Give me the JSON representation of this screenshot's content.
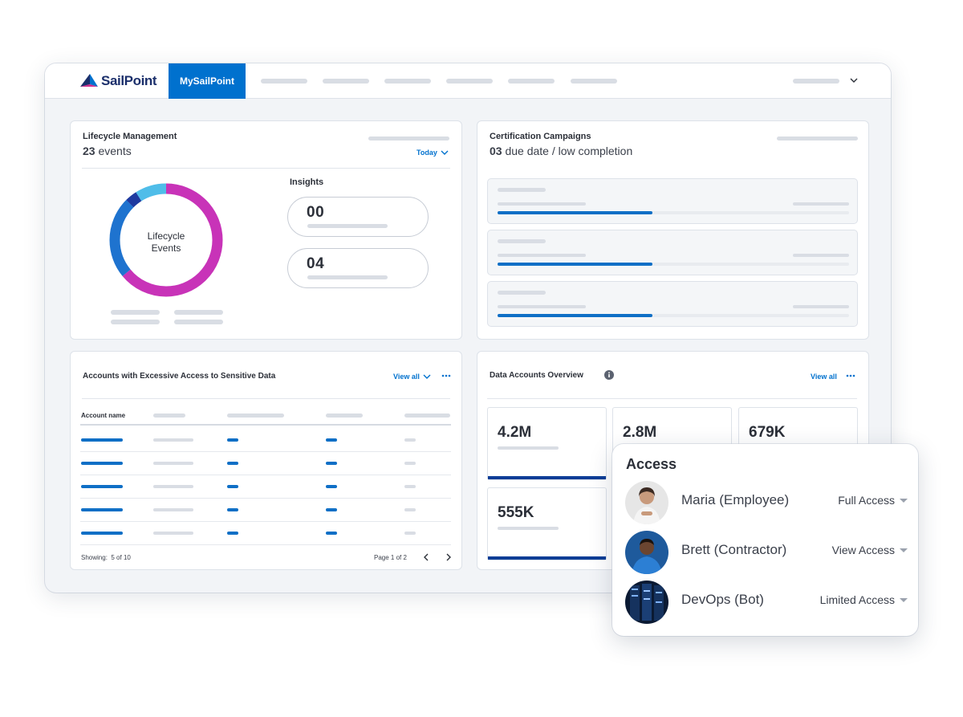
{
  "brand": {
    "name": "SailPoint",
    "tab": "MySailPoint"
  },
  "colors": {
    "primary": "#0071ce",
    "navy": "#0c3d96",
    "magenta": "#c833b8",
    "light_blue": "#4fbde9",
    "dark_blue": "#1f3aa0"
  },
  "lifecycle": {
    "title": "Lifecycle Management",
    "count": "23",
    "count_suffix": "events",
    "period": "Today",
    "donut_label_line1": "Lifecycle",
    "donut_label_line2": "Events",
    "insights_label": "Insights",
    "insights": [
      "00",
      "04"
    ]
  },
  "certification": {
    "title": "Certification Campaigns",
    "count": "03",
    "count_suffix": "due date / low completion",
    "progress": [
      0.44,
      0.44,
      0.44
    ]
  },
  "accounts": {
    "title": "Accounts with Excessive Access to Sensitive Data",
    "view_all": "View all",
    "column_header": "Account name",
    "row_count": 5,
    "showing_label": "Showing:",
    "showing_value": "5 of 10",
    "page": "Page 1 of 2"
  },
  "data_overview": {
    "title": "Data Accounts Overview",
    "view_all": "View all",
    "stats": [
      "4.2M",
      "2.8M",
      "679K",
      "555K"
    ]
  },
  "access": {
    "title": "Access",
    "people": [
      {
        "name": "Maria (Employee)",
        "level": "Full Access",
        "avatar": "person-avatar"
      },
      {
        "name": "Brett (Contractor)",
        "level": "View Access",
        "avatar": "person-avatar"
      },
      {
        "name": "DevOps (Bot)",
        "level": "Limited Access",
        "avatar": "server-avatar"
      }
    ]
  },
  "icons": {
    "chevron": "chevron-down-icon",
    "info": "info-icon",
    "more": "more-icon",
    "prev": "chevron-left-icon",
    "next": "chevron-right-icon"
  }
}
